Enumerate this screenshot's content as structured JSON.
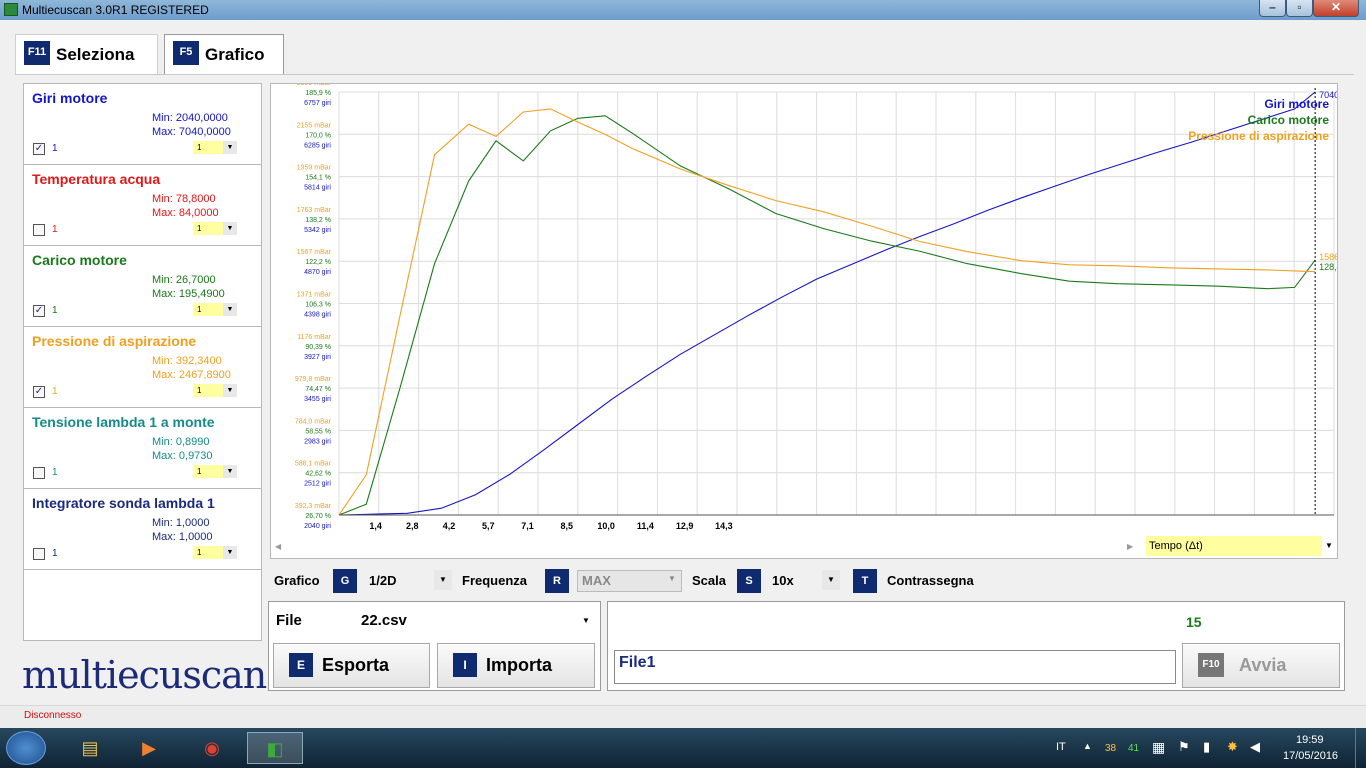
{
  "window": {
    "title": "Multiecuscan 3.0R1 REGISTERED"
  },
  "tabs": [
    {
      "key": "F11",
      "label": "Seleziona"
    },
    {
      "key": "F5",
      "label": "Grafico"
    }
  ],
  "parameters": [
    {
      "name": "Giri motore",
      "min": "Min: 2040,0000",
      "max": "Max: 7040,0000",
      "checked": "✓",
      "axis": "1",
      "axis_select": "1",
      "color": "#1515c8"
    },
    {
      "name": "Temperatura acqua",
      "min": "Min: 78,8000",
      "max": "Max: 84,0000",
      "checked": "",
      "axis": "1",
      "axis_select": "1",
      "color": "#e01818"
    },
    {
      "name": "Carico motore",
      "min": "Min: 26,7000",
      "max": "Max: 195,4900",
      "checked": "✓",
      "axis": "1",
      "axis_select": "1",
      "color": "#1a7a1a"
    },
    {
      "name": "Pressione di aspirazione",
      "min": "Min: 392,3400",
      "max": "Max: 2467,8900",
      "checked": "✓",
      "axis": "1",
      "axis_select": "1",
      "color": "#f0a020"
    },
    {
      "name": "Tensione lambda 1 a monte",
      "min": "Min: 0,8990",
      "max": "Max: 0,9730",
      "checked": "",
      "axis": "1",
      "axis_select": "1",
      "color": "#158a8a"
    },
    {
      "name": "Integratore sonda lambda 1",
      "min": "Min: 1,0000",
      "max": "Max: 1,0000",
      "checked": "",
      "axis": "1",
      "axis_select": "1",
      "color": "#1a2a7c"
    }
  ],
  "logo": {
    "text": "multiecuscan"
  },
  "chart_data": {
    "type": "line",
    "xlabel": "Tempo (Δt)",
    "x_ticks": [
      "1,4",
      "2,8",
      "4,2",
      "5,7",
      "7,1",
      "8,5",
      "10,0",
      "11,4",
      "12,9",
      "14,3"
    ],
    "xlim": [
      0,
      38
    ],
    "y_tick_labels": [
      {
        "press": "392,3 mBar",
        "load": "26,70 %",
        "rpm": "2040 giri"
      },
      {
        "press": "588,1 mBar",
        "load": "42,62 %",
        "rpm": "2512 giri"
      },
      {
        "press": "784,0 mBar",
        "load": "58,55 %",
        "rpm": "2983 giri"
      },
      {
        "press": "979,8 mBar",
        "load": "74,47 %",
        "rpm": "3455 giri"
      },
      {
        "press": "1176 mBar",
        "load": "90,39 %",
        "rpm": "3927 giri"
      },
      {
        "press": "1371 mBar",
        "load": "106,3 %",
        "rpm": "4398 giri"
      },
      {
        "press": "1567 mBar",
        "load": "122,2 %",
        "rpm": "4870 giri"
      },
      {
        "press": "1763 mBar",
        "load": "138,2 %",
        "rpm": "5342 giri"
      },
      {
        "press": "1959 mBar",
        "load": "154,1 %",
        "rpm": "5814 giri"
      },
      {
        "press": "2155 mBar",
        "load": "170,0 %",
        "rpm": "6285 giri"
      },
      {
        "press": "2350 mBar",
        "load": "185,9 %",
        "rpm": "6757 giri"
      }
    ],
    "series": [
      {
        "name": "Giri motore",
        "color": "#1515c8",
        "x": [
          0,
          1,
          1.5,
          2,
          2.5,
          3,
          3.5,
          4,
          4.5,
          5,
          5.5,
          6,
          6.5,
          7,
          7.5,
          8,
          8.5,
          9,
          9.5,
          10,
          10.5,
          11,
          11.5,
          12,
          12.5,
          13,
          13.5,
          14,
          14.3
        ],
        "y": [
          2040,
          2060,
          2120,
          2280,
          2520,
          2810,
          3110,
          3410,
          3680,
          3940,
          4170,
          4400,
          4620,
          4830,
          5000,
          5170,
          5330,
          5480,
          5640,
          5790,
          5930,
          6070,
          6200,
          6330,
          6450,
          6580,
          6710,
          6840,
          7040
        ]
      },
      {
        "name": "Carico motore",
        "color": "#1a7a1a",
        "x": [
          0,
          0.4,
          0.9,
          1.4,
          1.9,
          2.3,
          2.7,
          3.1,
          3.5,
          3.9,
          4.3,
          5,
          5.7,
          6.4,
          7.1,
          7.8,
          8.5,
          9.2,
          10,
          10.7,
          11.4,
          12.2,
          12.9,
          13.6,
          14,
          14.3
        ],
        "y": [
          26.7,
          31,
          78,
          127,
          160,
          176,
          168,
          180,
          185,
          186,
          179,
          166,
          157,
          147,
          141,
          136,
          132,
          127,
          123,
          120,
          119,
          118.5,
          118,
          117,
          117.5,
          128.4
        ]
      },
      {
        "name": "Pressione di aspirazione",
        "color": "#f0a020",
        "x": [
          0,
          0.4,
          0.9,
          1.4,
          1.9,
          2.3,
          2.7,
          3.1,
          3.5,
          3.9,
          4.3,
          5,
          5.7,
          6.4,
          7.1,
          7.8,
          8.5,
          9.2,
          10,
          10.7,
          11.4,
          12.2,
          12.9,
          13.6,
          14,
          14.3
        ],
        "y": [
          392,
          590,
          1380,
          2160,
          2310,
          2250,
          2370,
          2385,
          2320,
          2260,
          2190,
          2090,
          2010,
          1935,
          1880,
          1810,
          1735,
          1685,
          1640,
          1620,
          1615,
          1605,
          1600,
          1595,
          1590,
          1586
        ]
      }
    ],
    "cursor": {
      "x": 14.3,
      "rpm": "7040 giri",
      "press": "1586 mBar",
      "load": "128,4 %"
    }
  },
  "legend": [
    "Giri motore",
    "Carico motore",
    "Pressione di aspirazione"
  ],
  "xaxis_select": "Tempo (Δt)",
  "controls": {
    "grafico_label": "Grafico",
    "grafico_key": "G",
    "grafico_value": "1/2D",
    "frequenza_label": "Frequenza",
    "frequenza_key": "R",
    "frequenza_value": "MAX",
    "scala_label": "Scala",
    "scala_key": "S",
    "scala_value": "10x",
    "contrassegna_key": "T",
    "contrassegna_label": "Contrassegna"
  },
  "file_panel": {
    "file_label": "File",
    "file_value": "22.csv",
    "esporta_key": "E",
    "esporta_label": "Esporta",
    "importa_key": "I",
    "importa_label": "Importa"
  },
  "run_panel": {
    "count": "15",
    "name_value": "File1",
    "avvia_key": "F10",
    "avvia_label": "Avvia"
  },
  "status": {
    "text": "Disconnesso"
  },
  "taskbar": {
    "lang": "IT",
    "tray_a": "38",
    "tray_b": "41",
    "time": "19:59",
    "date": "17/05/2016"
  }
}
